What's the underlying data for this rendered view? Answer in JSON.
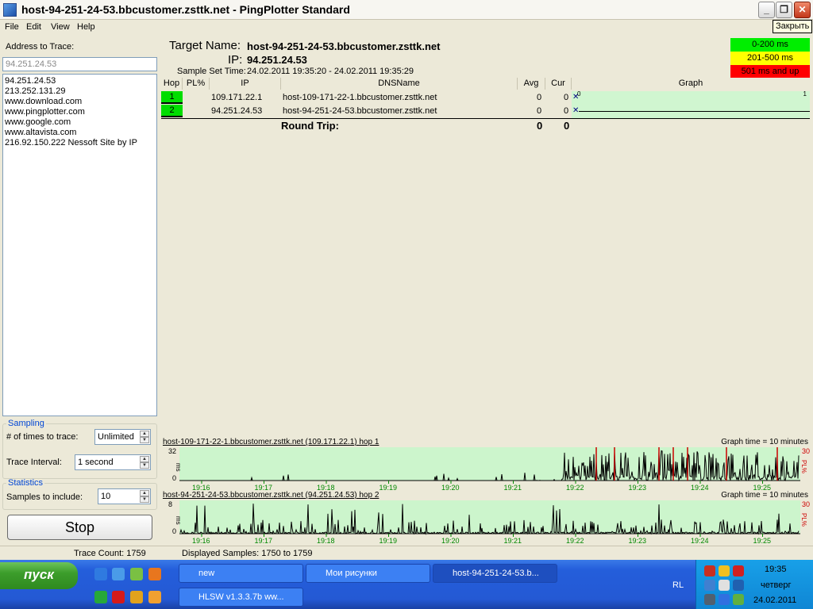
{
  "window": {
    "title": "host-94-251-24-53.bbcustomer.zsttk.net - PingPlotter Standard",
    "tooltip": "Закрыть",
    "min_glyph": "_",
    "max_glyph": "❐",
    "close_glyph": "✕"
  },
  "menu": [
    "File",
    "Edit",
    "View",
    "Help"
  ],
  "left": {
    "address_label": "Address to Trace:",
    "address_value": "94.251.24.53",
    "history": [
      "94.251.24.53",
      "213.252.131.29",
      "www.download.com",
      "www.pingplotter.com",
      "www.google.com",
      "www.altavista.com",
      "216.92.150.222 Nessoft Site by IP"
    ],
    "sampling": {
      "legend": "Sampling",
      "times_label": "# of times to trace:",
      "times_value": "Unlimited",
      "interval_label": "Trace Interval:",
      "interval_value": "1 second"
    },
    "statistics": {
      "legend": "Statistics",
      "samples_label": "Samples to include:",
      "samples_value": "10"
    },
    "stop_label": "Stop"
  },
  "target": {
    "name_label": "Target Name:",
    "name_value": "host-94-251-24-53.bbcustomer.zsttk.net",
    "ip_label": "IP:",
    "ip_value": "94.251.24.53",
    "time_label": "Sample Set Time:",
    "time_value": "24.02.2011 19:35:20 - 24.02.2011 19:35:29"
  },
  "latency_legend": [
    {
      "label": "0-200 ms",
      "color": "#00ee00"
    },
    {
      "label": "201-500 ms",
      "color": "#ffff00"
    },
    {
      "label": "501 ms and up",
      "color": "#ff0000"
    }
  ],
  "table": {
    "headers": [
      "Hop",
      "PL%",
      "IP",
      "DNSName",
      "Avg",
      "Cur",
      "Graph"
    ],
    "rows": [
      {
        "hop": "1",
        "pl": "",
        "ip": "109.171.22.1",
        "dns": "host-109-171-22-1.bbcustomer.zsttk.net",
        "avg": "0",
        "cur": "0"
      },
      {
        "hop": "2",
        "pl": "",
        "ip": "94.251.24.53",
        "dns": "host-94-251-24-53.bbcustomer.zsttk.net",
        "avg": "0",
        "cur": "0"
      }
    ],
    "graph_scale_left": "0",
    "graph_scale_right": "1",
    "round_trip_label": "Round Trip:",
    "round_trip_avg": "0",
    "round_trip_cur": "0"
  },
  "time_graphs": [
    {
      "title": "host-109-171-22-1.bbcustomer.zsttk.net (109.171.22.1) hop 1",
      "graph_time": "Graph time = 10 minutes",
      "y_max": "32",
      "y_min": "0",
      "y_unit": "ms",
      "pl_max": "30",
      "pl_unit": "PL%"
    },
    {
      "title": "host-94-251-24-53.bbcustomer.zsttk.net (94.251.24.53) hop 2",
      "graph_time": "Graph time = 10 minutes",
      "y_max": "8",
      "y_min": "0",
      "y_unit": "ms",
      "pl_max": "30",
      "pl_unit": "PL%"
    }
  ],
  "time_ticks": [
    "19:16",
    "19:17",
    "19:18",
    "19:19",
    "19:20",
    "19:21",
    "19:22",
    "19:23",
    "19:24",
    "19:25"
  ],
  "status": {
    "trace_count": "Trace Count: 1759",
    "displayed": "Displayed Samples: 1750 to 1759"
  },
  "taskbar": {
    "start": "пуск",
    "buttons": [
      {
        "label": "new"
      },
      {
        "label": "Мои рисунки"
      },
      {
        "label": "host-94-251-24-53.b..."
      },
      {
        "label": "HLSW v1.3.3.7b   ww..."
      }
    ],
    "lang": "RL",
    "clock": "19:35",
    "day": "четверг",
    "date": "24.02.2011"
  },
  "colors": {
    "graph_bg": "#ccf5cc",
    "graph_line": "#000000",
    "loss_line": "#cc0000",
    "tick_color": "#008800"
  }
}
